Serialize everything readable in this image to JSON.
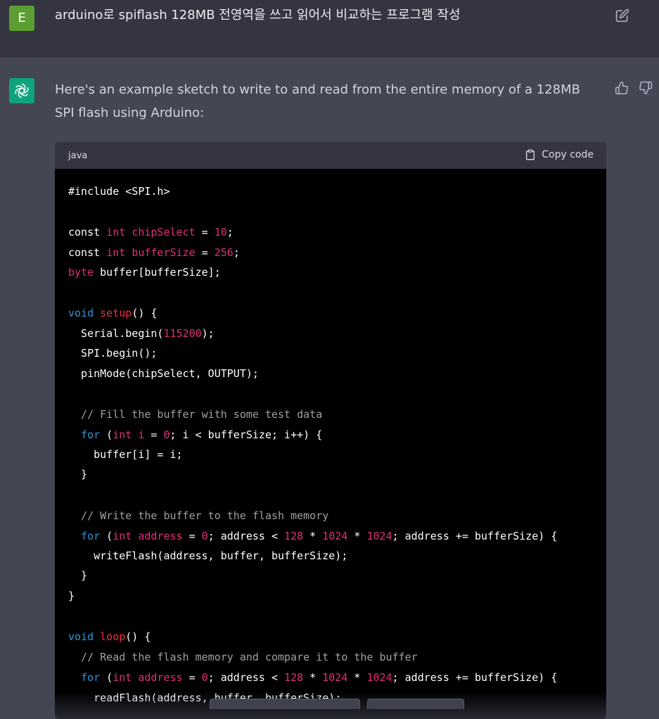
{
  "user": {
    "avatar_letter": "E",
    "message": "arduino로 spiflash 128MB 전영역을 쓰고 읽어서 비교하는 프로그램 작성"
  },
  "assistant": {
    "intro": "Here's an example sketch to write to and read from the entire memory of a 128MB SPI flash using Arduino:",
    "code": {
      "language": "java",
      "copy_label": "Copy code"
    }
  },
  "colors": {
    "user_avatar": "#5c9e31",
    "assistant_avatar": "#10a37f",
    "keyword": "#2e95d3",
    "type_number": "#df3079",
    "comment": "#a0a0a0"
  }
}
